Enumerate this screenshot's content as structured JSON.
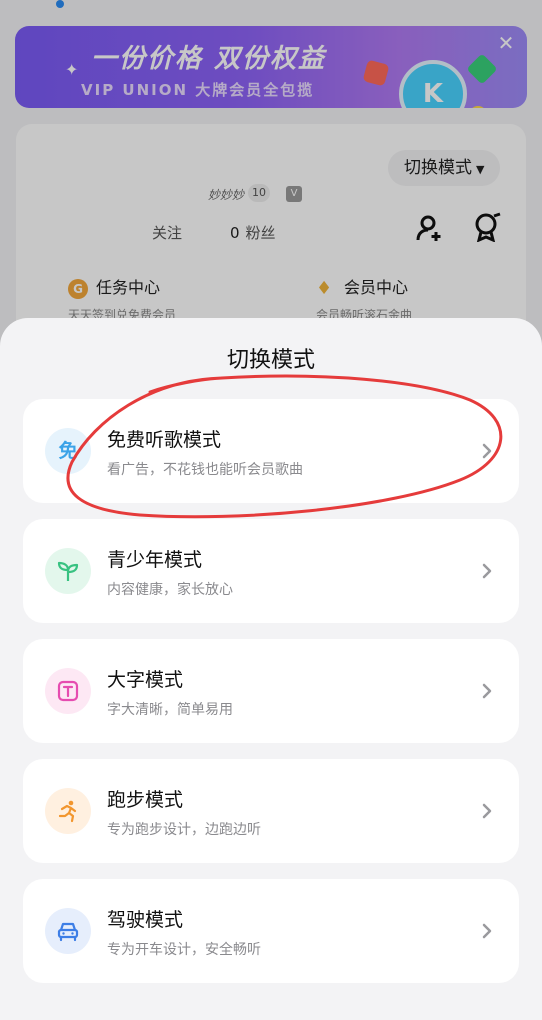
{
  "background": {
    "banner": {
      "title": "一份价格 双份权益",
      "subtitle": "VIP UNION 大牌会员全包揽",
      "badge_letter": "K"
    },
    "profile": {
      "mode_switch_label": "切换模式",
      "username": "妙妙妙",
      "level": "10",
      "vip_badge": "V",
      "follow_count": "",
      "follow_label": "关注",
      "fans_count": "0",
      "fans_label": "粉丝",
      "task_center": "任务中心",
      "task_center_icon": "G",
      "task_sub": "天天签到兑免费会员",
      "vip_center": "会员中心",
      "vip_sub": "会员畅听滚石金曲"
    }
  },
  "sheet": {
    "title": "切换模式",
    "modes": [
      {
        "name": "免费听歌模式",
        "desc": "看广告，不花钱也能听会员歌曲",
        "icon": "free-mode-icon",
        "color": "#3ba3e8",
        "bg": "#e6f3fc"
      },
      {
        "name": "青少年模式",
        "desc": "内容健康，家长放心",
        "icon": "sprout-icon",
        "color": "#38c281",
        "bg": "#e3f7ec"
      },
      {
        "name": "大字模式",
        "desc": "字大清晰，简单易用",
        "icon": "text-size-icon",
        "color": "#e64cb0",
        "bg": "#fde8f4"
      },
      {
        "name": "跑步模式",
        "desc": "专为跑步设计，边跑边听",
        "icon": "running-icon",
        "color": "#f2962e",
        "bg": "#fff0e0"
      },
      {
        "name": "驾驶模式",
        "desc": "专为开车设计，安全畅听",
        "icon": "car-icon",
        "color": "#3d7ee6",
        "bg": "#e6eefc"
      }
    ]
  },
  "free_icon_glyph": "免"
}
